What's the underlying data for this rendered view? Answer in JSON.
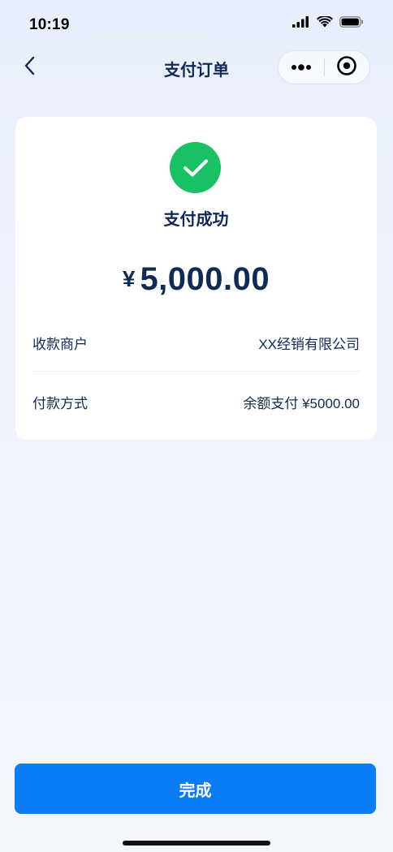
{
  "status_bar": {
    "time": "10:19",
    "icons": [
      "signal-icon",
      "wifi-icon",
      "battery-icon"
    ]
  },
  "nav": {
    "title": "支付订单",
    "back_icon": "chevron-left-icon",
    "more_icon": "more-dots-icon",
    "close_icon": "target-circle-icon"
  },
  "result": {
    "status_text": "支付成功",
    "currency_symbol": "¥",
    "amount": "5,000.00",
    "status_color": "#18c163"
  },
  "details": [
    {
      "label": "收款商户",
      "value": "XX经销有限公司"
    },
    {
      "label": "付款方式",
      "value": "余额支付 ¥5000.00"
    }
  ],
  "actions": {
    "done_label": "完成",
    "accent_color": "#0a7cf6"
  }
}
